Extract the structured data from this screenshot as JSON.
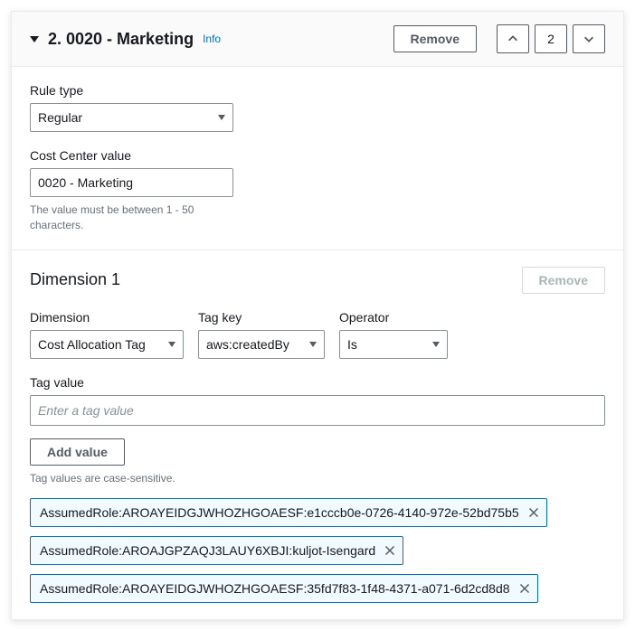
{
  "header": {
    "title": "2. 0020 - Marketing",
    "info": "Info",
    "remove": "Remove",
    "position": "2"
  },
  "ruleType": {
    "label": "Rule type",
    "value": "Regular"
  },
  "costCenter": {
    "label": "Cost Center value",
    "value": "0020 - Marketing",
    "help": "The value must be between 1 - 50 characters."
  },
  "dimension": {
    "title": "Dimension 1",
    "remove": "Remove",
    "fields": {
      "dimension": {
        "label": "Dimension",
        "value": "Cost Allocation Tag"
      },
      "tagKey": {
        "label": "Tag key",
        "value": "aws:createdBy"
      },
      "operator": {
        "label": "Operator",
        "value": "Is"
      }
    }
  },
  "tagValue": {
    "label": "Tag value",
    "placeholder": "Enter a tag value",
    "addButton": "Add value",
    "help": "Tag values are case-sensitive.",
    "values": [
      "AssumedRole:AROAYEIDGJWHOZHGOAESF:e1cccb0e-0726-4140-972e-52bd75b5",
      "AssumedRole:AROAJGPZAQJ3LAUY6XBJI:kuljot-Isengard",
      "AssumedRole:AROAYEIDGJWHOZHGOAESF:35fd7f83-1f48-4371-a071-6d2cd8d8"
    ]
  }
}
